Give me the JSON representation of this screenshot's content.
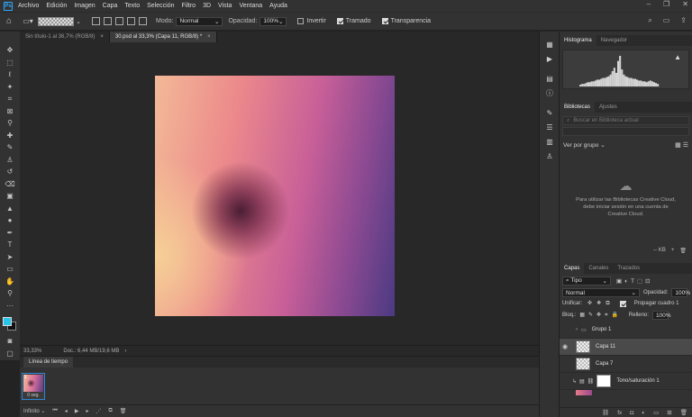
{
  "menu": {
    "logo": "Ps",
    "items": [
      "Archivo",
      "Edición",
      "Imagen",
      "Capa",
      "Texto",
      "Selección",
      "Filtro",
      "3D",
      "Vista",
      "Ventana",
      "Ayuda"
    ]
  },
  "options": {
    "mode_label": "Modo:",
    "mode_value": "Normal",
    "opacity_label": "Opacidad:",
    "opacity_value": "100%",
    "invert_label": "Invertir",
    "invert_checked": false,
    "dither_label": "Tramado",
    "dither_checked": true,
    "transparency_label": "Transparencia",
    "transparency_checked": true
  },
  "doc_tabs": [
    {
      "label": "Sin título-1 al 36,7% (RGB/8)",
      "active": false
    },
    {
      "label": "30.psd al 33,3% (Capa 11, RGB/8) *",
      "active": true
    }
  ],
  "status": {
    "zoom": "33,33%",
    "doc": "Doc.: 6,44 MB/19,6 MB"
  },
  "timeline": {
    "title": "Línea de tiempo",
    "frame_number": "1",
    "frame_duration": "0 seg.",
    "loop": "Infinito"
  },
  "histogram": {
    "tabs": [
      "Histograma",
      "Navegador"
    ],
    "bars": [
      2,
      3,
      3,
      4,
      5,
      5,
      6,
      6,
      7,
      8,
      8,
      9,
      10,
      10,
      11,
      12,
      14,
      18,
      22,
      16,
      30,
      36,
      20,
      14,
      12,
      11,
      10,
      10,
      9,
      9,
      8,
      7,
      7,
      6,
      6,
      5,
      6,
      7,
      6,
      5,
      4,
      3
    ],
    "warning_icon": "warning-icon"
  },
  "libraries": {
    "tabs": [
      "Bibliotecas",
      "Ajustes"
    ],
    "search_placeholder": "Buscar en Biblioteca actual",
    "view_label": "Ver por grupo",
    "cloud_message": "Para utilizar las Bibliotecas Creative Cloud, debe iniciar sesión en una cuenta de Creative Cloud.",
    "size": "-- KB"
  },
  "layers": {
    "tabs": [
      "Capas",
      "Canales",
      "Trazados"
    ],
    "filter_value": "Tipo",
    "blend_value": "Normal",
    "opacity_label": "Opacidad:",
    "opacity_value": "100%",
    "unify_label": "Unificar:",
    "propagate_label": "Propagar cuadro 1",
    "lock_label": "Bloq.:",
    "fill_label": "Relleno:",
    "fill_value": "100%",
    "rows": [
      {
        "name": "Grupo 1",
        "visible": false,
        "selected": false,
        "kind": "group"
      },
      {
        "name": "Capa 11",
        "visible": true,
        "selected": true,
        "kind": "layer"
      },
      {
        "name": "Capa 7",
        "visible": false,
        "selected": false,
        "kind": "layer"
      },
      {
        "name": "Tono/saturación 1",
        "visible": false,
        "selected": false,
        "kind": "adjustment"
      }
    ]
  },
  "colors": {
    "accent": "#31a8ff",
    "foreground_swatch": "#25c6e8",
    "background_swatch": "#111111"
  }
}
